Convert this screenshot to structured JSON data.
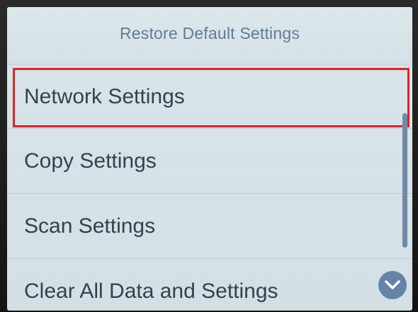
{
  "screen": {
    "title": "Restore Default Settings"
  },
  "menu": {
    "items": [
      {
        "label": "Network Settings"
      },
      {
        "label": "Copy Settings"
      },
      {
        "label": "Scan Settings"
      },
      {
        "label": "Clear All Data and Settings"
      }
    ]
  },
  "icons": {
    "scroll_down": "chevron-down-icon"
  },
  "colors": {
    "highlight_border": "#e01b1b",
    "accent": "#5f7fa3",
    "title_text": "#5a7890",
    "item_text": "#2e3a44",
    "screen_background": "#d6e3e8"
  }
}
